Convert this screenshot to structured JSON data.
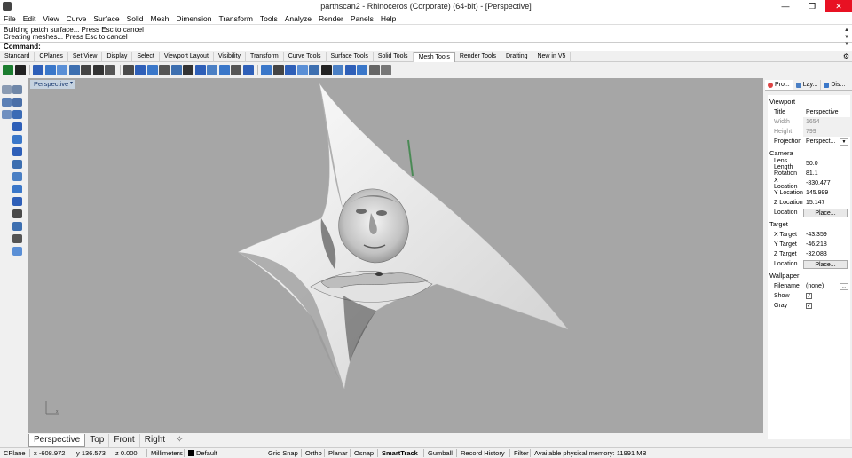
{
  "window": {
    "title": "parthscan2 - Rhinoceros (Corporate) (64-bit) - [Perspective]",
    "minimize": "—",
    "maximize": "❐",
    "close": "✕"
  },
  "menu": [
    "File",
    "Edit",
    "View",
    "Curve",
    "Surface",
    "Solid",
    "Mesh",
    "Dimension",
    "Transform",
    "Tools",
    "Analyze",
    "Render",
    "Panels",
    "Help"
  ],
  "command": {
    "history": [
      "Building patch surface... Press Esc to cancel",
      "Creating meshes... Press Esc to cancel"
    ],
    "prompt": "Command:",
    "value": ""
  },
  "toolbar_tabs": [
    "Standard",
    "CPlanes",
    "Set View",
    "Display",
    "Select",
    "Viewport Layout",
    "Visibility",
    "Transform",
    "Curve Tools",
    "Surface Tools",
    "Solid Tools",
    "Mesh Tools",
    "Render Tools",
    "Drafting",
    "New in V5"
  ],
  "toolbar_active_tab": "Mesh Tools",
  "viewport": {
    "title": "Perspective",
    "dropdown": "▾",
    "axis_label": "x"
  },
  "viewport_tabs": [
    "Perspective",
    "Top",
    "Front",
    "Right"
  ],
  "viewport_active_tab": "Perspective",
  "viewport_add": "✧",
  "status": {
    "cplane": "CPlane",
    "x": "x -608.972",
    "y": "y 136.573",
    "z": "z 0.000",
    "units": "Millimeters",
    "layer": "Default",
    "grid_snap": "Grid Snap",
    "ortho": "Ortho",
    "planar": "Planar",
    "osnap": "Osnap",
    "smarttrack": "SmartTrack",
    "gumball": "Gumball",
    "record_history": "Record History",
    "filter": "Filter",
    "memory": "Available physical memory: 11991 MB"
  },
  "panel": {
    "tabs": [
      "Pro...",
      "Lay...",
      "Dis..."
    ],
    "sections": {
      "viewport": "Viewport",
      "camera": "Camera",
      "target": "Target",
      "wallpaper": "Wallpaper"
    },
    "viewport_props": {
      "title_label": "Title",
      "title_value": "Perspective",
      "width_label": "Width",
      "width_value": "1654",
      "height_label": "Height",
      "height_value": "799",
      "projection_label": "Projection",
      "projection_value": "Perspect..."
    },
    "camera_props": {
      "lens_label": "Lens Length",
      "lens_value": "50.0",
      "rotation_label": "Rotation",
      "rotation_value": "81.1",
      "xloc_label": "X Location",
      "xloc_value": "-830.477",
      "yloc_label": "Y Location",
      "yloc_value": "145.999",
      "zloc_label": "Z Location",
      "zloc_value": "15.147",
      "location_label": "Location",
      "place_button": "Place..."
    },
    "target_props": {
      "xt_label": "X Target",
      "xt_value": "-43.359",
      "yt_label": "Y Target",
      "yt_value": "-46.218",
      "zt_label": "Z Target",
      "zt_value": "-32.083",
      "location_label": "Location",
      "place_button": "Place..."
    },
    "wallpaper_props": {
      "filename_label": "Filename",
      "filename_value": "(none)",
      "browse": "...",
      "show_label": "Show",
      "show_checked": "✓",
      "gray_label": "Gray",
      "gray_checked": "✓"
    }
  },
  "colors": {
    "viewport_bg": "#a6a6a6",
    "close_button": "#e81123",
    "viewport_title_bg": "#c6d3e0"
  }
}
